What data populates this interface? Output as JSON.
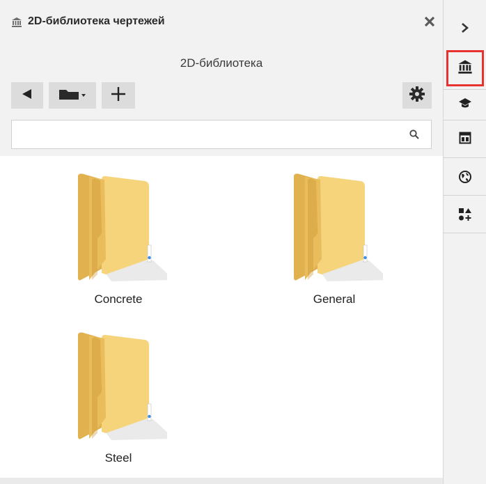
{
  "panel": {
    "title": "2D-библиотека чертежей",
    "subtitle": "2D-библиотека",
    "close_icon": "close-icon",
    "title_icon": "library-icon"
  },
  "toolbar": {
    "buttons": [
      {
        "name": "back-button",
        "icon": "triangle-left-icon"
      },
      {
        "name": "folder-dropdown-button",
        "icon": "folder-icon"
      },
      {
        "name": "add-button",
        "icon": "plus-icon"
      },
      {
        "name": "settings-button",
        "icon": "gear-icon"
      }
    ]
  },
  "search": {
    "value": "",
    "placeholder": "",
    "icon": "search-icon"
  },
  "folders": [
    {
      "label": "Concrete"
    },
    {
      "label": "General"
    },
    {
      "label": "Steel"
    }
  ],
  "rail": {
    "items": [
      {
        "name": "collapse-arrow",
        "icon": "chevron-right-icon"
      },
      {
        "name": "library",
        "icon": "library-icon",
        "active": true
      },
      {
        "name": "learning",
        "icon": "graduation-cap-icon"
      },
      {
        "name": "layout",
        "icon": "layout-icon"
      },
      {
        "name": "globe",
        "icon": "globe-icon"
      },
      {
        "name": "shapes",
        "icon": "shapes-icon"
      }
    ],
    "active_color": "#e8322f"
  },
  "colors": {
    "panel_bg": "#f2f2f2",
    "button_bg": "#dcdcdc",
    "folder_yellow": "#f5cf73"
  }
}
